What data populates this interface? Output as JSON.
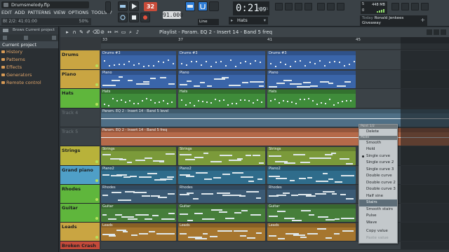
{
  "app": {
    "file_name": "Drumsmelody.flp",
    "menu": [
      "EDIT",
      "ADD",
      "PATTERNS",
      "VIEW",
      "OPTIONS",
      "TOOLS",
      "?"
    ],
    "hint": "Bt 2/2: 41:01:00",
    "zoom": "50%",
    "pattern_number": "32",
    "tempo": "91.000",
    "time": "0:21",
    "time_frac": "09",
    "time_unit": "M:S:CS",
    "pattern_name": "Hats",
    "snap_mode": "Line",
    "cpu": {
      "value": "5",
      "memory": "448 MB",
      "voices": "0"
    },
    "news": {
      "today": "Today",
      "author": "Ronald Jenkees",
      "title": "Giveaway"
    }
  },
  "browser": {
    "header": "Brows Current project",
    "current_project": "Current project",
    "items": [
      "History",
      "Patterns",
      "Effects",
      "Generators",
      "Remote control"
    ]
  },
  "playlist": {
    "title": "Playlist - Param. EQ 2 - Insert 14 - Band 5 freq",
    "ruler_marks": [
      "33",
      "37",
      "41",
      "45"
    ],
    "tracks": [
      {
        "name": "Drums",
        "color": "#c9a542",
        "clip_color": "#3a65a9",
        "clip_label": "Drums #3"
      },
      {
        "name": "Piano",
        "color": "#c9a542",
        "clip_color": "#3a65a9",
        "clip_label": "Piano"
      },
      {
        "name": "Hats",
        "color": "#5fb63c",
        "clip_color": "#3f8c3a",
        "clip_label": "Hats"
      },
      {
        "name": "Track 4",
        "color": "#3d4449",
        "clip_color": "#4f6f86",
        "clip_label": "Param. EQ 2 - Insert 14 - Band 5 level"
      },
      {
        "name": "Track 5",
        "color": "#3d4449",
        "clip_color": "#b56a4a",
        "clip_label": "Param. EQ 2 - Insert 14 - Band 5 freq"
      },
      {
        "name": "Strings",
        "color": "#b8b23a",
        "clip_color": "#7b9a3a",
        "clip_label": "Strings"
      },
      {
        "name": "Grand piano",
        "color": "#4f9fc7",
        "clip_color": "#2f6c8b",
        "clip_label": "Piano2"
      },
      {
        "name": "Rhodes",
        "color": "#5fb63c",
        "clip_color": "#3b5a74",
        "clip_label": "Rhodes"
      },
      {
        "name": "Guitar",
        "color": "#5fb63c",
        "clip_color": "#467e3a",
        "clip_label": "Guitar"
      },
      {
        "name": "Leads",
        "color": "#c9a542",
        "clip_color": "#a6762e",
        "clip_label": "Leads"
      },
      {
        "name": "Broken Crash",
        "color": "#c44a3a",
        "clip_color": "#9c3a2e",
        "clip_label": "Broken Crash"
      }
    ]
  },
  "context_menu": {
    "header1": "Point 1/2",
    "delete_label": "Delete",
    "header2": "Mode",
    "modes": [
      "Smooth",
      "Hold",
      "Single curve",
      "Single curve 2",
      "Single curve 3",
      "Double curve",
      "Double curve 2",
      "Double curve 3",
      "Half sine",
      "Stairs",
      "Smooth stairs",
      "Pulse",
      "Wave"
    ],
    "checked": "Single curve",
    "selected": "Stairs",
    "copy_label": "Copy value",
    "paste_label": "Paste value"
  }
}
